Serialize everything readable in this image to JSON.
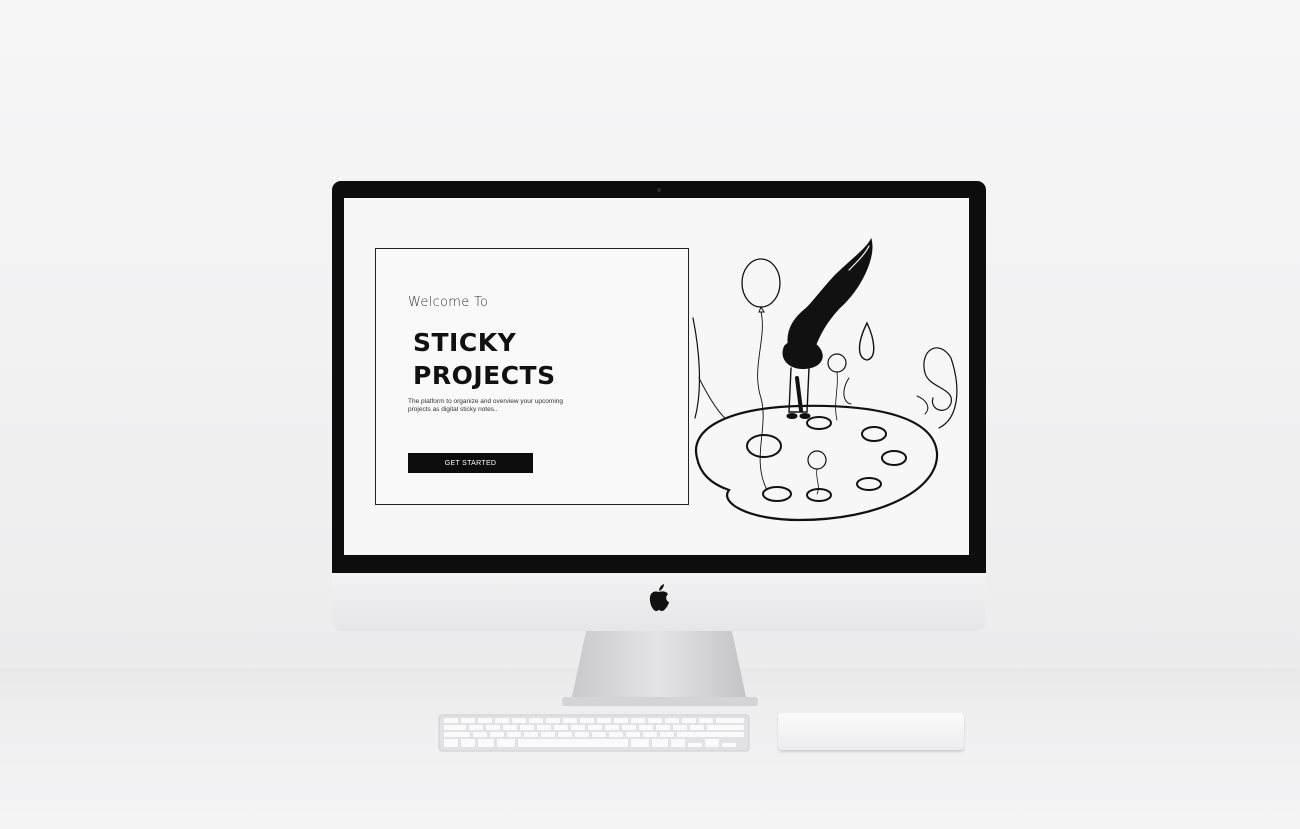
{
  "screen": {
    "hero": {
      "welcome": "Welcome To",
      "title_line1": "STICKY",
      "title_line2": "PROJECTS",
      "tagline": "The platform to organize and overview your upcoming projects as digital sticky notes..",
      "cta_label": "GET STARTED"
    },
    "illustration": "paint-palette-with-brush-and-balloons"
  },
  "colors": {
    "screen_background": "#f7f7f7",
    "button_background": "#0c0c0c",
    "button_text": "#ffffff",
    "bezel": "#0d0d0d"
  },
  "icons": {
    "logo": "apple-icon"
  }
}
